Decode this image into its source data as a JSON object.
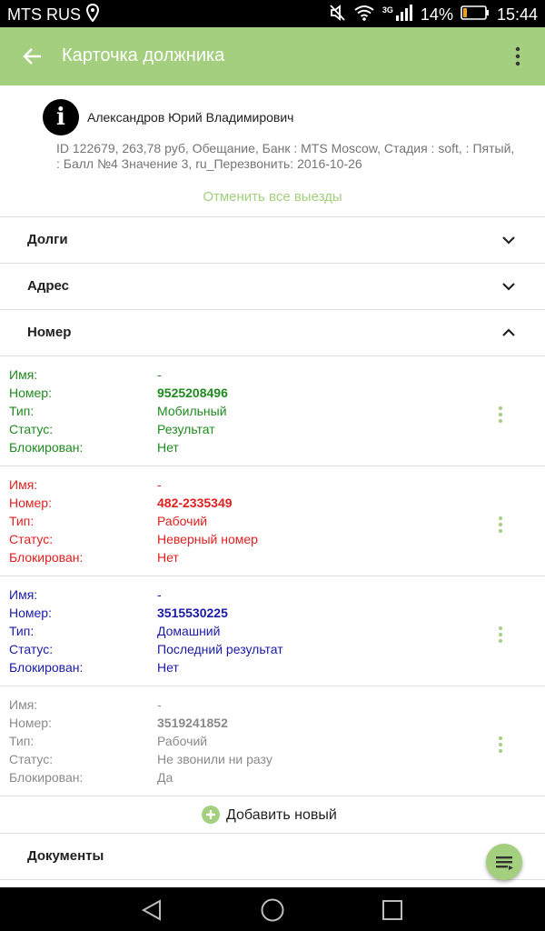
{
  "status_bar": {
    "carrier": "MTS RUS",
    "network": "3G",
    "battery": "14%",
    "time": "15:44",
    "icons": [
      "location-icon",
      "mute-icon",
      "wifi-icon",
      "signal-icon",
      "battery-icon"
    ]
  },
  "app_bar": {
    "title": "Карточка должника",
    "icons": [
      "back-arrow-icon",
      "more-vert-icon"
    ]
  },
  "debtor": {
    "name": "Александров Юрий Владимирович",
    "details": "ID 122679, 263,78 руб, Обещание, Банк : MTS Moscow, Стадия : soft, : Пятый, : Балл №4 Значение 3, ru_Перезвонить: 2016-10-26",
    "cancel_link": "Отменить все выезды",
    "icon": "info-icon"
  },
  "sections": {
    "debts": "Долги",
    "address": "Адрес",
    "number": "Номер",
    "documents": "Документы"
  },
  "labels": {
    "name": "Имя:",
    "number": "Номер:",
    "type": "Тип:",
    "status": "Статус:",
    "blocked": "Блокирован:"
  },
  "phones": [
    {
      "name": "-",
      "number": "9525208496",
      "type": "Мобильный",
      "status": "Результат",
      "blocked": "Нет",
      "color": "#1f8a1f"
    },
    {
      "name": "-",
      "number": "482-2335349",
      "type": "Рабочий",
      "status": "Неверный номер",
      "blocked": "Нет",
      "color": "#e02020"
    },
    {
      "name": "-",
      "number": "3515530225",
      "type": "Домашний",
      "status": "Последний результат",
      "blocked": "Нет",
      "color": "#1a1aa8"
    },
    {
      "name": "-",
      "number": "3519241852",
      "type": "Рабочий",
      "status": "Не звонили ни разу",
      "blocked": "Да",
      "color": "#8a8a8a"
    }
  ],
  "add_new": "Добавить новый",
  "colors": {
    "accent": "#a3cf7f",
    "status_bar": "#000000",
    "nav_bar": "#000000"
  }
}
